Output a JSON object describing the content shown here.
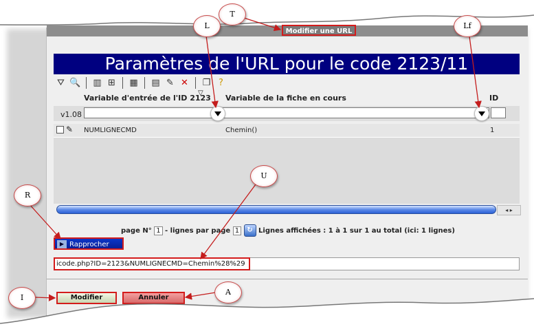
{
  "window": {
    "title": "Modifier une URL"
  },
  "banner": {
    "title": "Paramètres de l'URL pour le code 2123/11"
  },
  "toolbar": {
    "icons": [
      "filter-icon",
      "search-icon",
      "columns-icon",
      "tree-icon",
      "grid-icon",
      "export-icon",
      "edit-icon",
      "delete-icon",
      "copy-icon",
      "help-icon"
    ]
  },
  "table": {
    "columns": [
      "Variable d'entrée de l'ID 2123",
      "Variable de la fiche en cours",
      "ID"
    ],
    "filter_version": "v1.08",
    "rows": [
      {
        "variable": "NUMLIGNECMD",
        "fiche": "Chemin()",
        "id": "1"
      }
    ]
  },
  "pager": {
    "label_page": "page N°",
    "page": "1",
    "label_lines": "- lignes par page",
    "lines_per_page": "1",
    "summary": "Lignes affichées : 1 à 1 sur 1 au total (ici: 1 lignes)"
  },
  "rapprocher_label": "Rapprocher",
  "url_value": "icode.php?ID=2123&NUMLIGNECMD=Chemin%28%29",
  "buttons": {
    "modifier": "Modifier",
    "annuler": "Annuler"
  },
  "callouts": {
    "T": "T",
    "L": "L",
    "Lf": "Lf",
    "U": "U",
    "R": "R",
    "I": "I",
    "A": "A"
  },
  "colors": {
    "banner": "#000080",
    "callout_border": "#d31b1b",
    "annuler": "#d86a6a"
  }
}
